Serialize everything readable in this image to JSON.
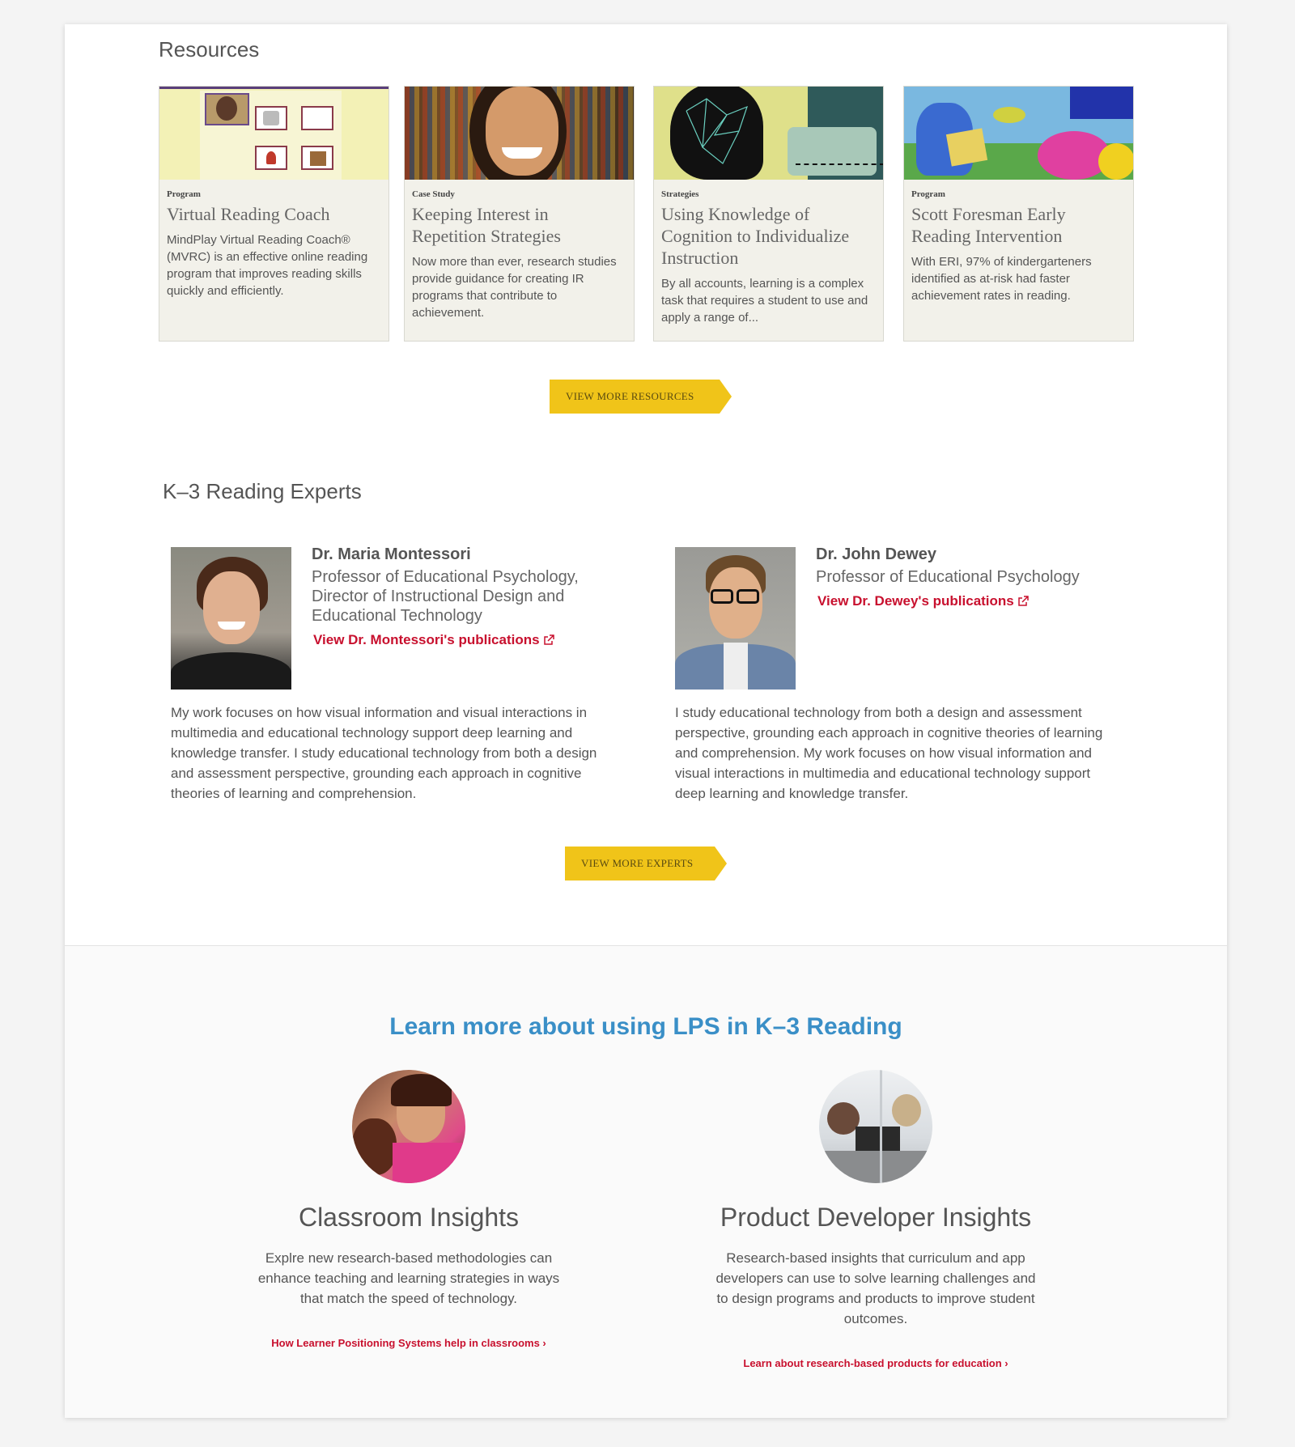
{
  "resources": {
    "title": "Resources",
    "cards": [
      {
        "type": "Program",
        "title": "Virtual Reading Coach",
        "desc": "MindPlay Virtual Reading Coach® (MVRC) is an effective online reading program that improves reading skills quickly and efficiently."
      },
      {
        "type": "Case Study",
        "title": "Keeping Interest in Repetition Strategies",
        "desc": "Now more than ever, research studies provide guidance for creating IR programs that contribute to achievement."
      },
      {
        "type": "Strategies",
        "title": "Using Knowledge of Cognition to Individualize Instruction",
        "desc": "By all accounts, learning is a complex task that requires a student to use and apply a range of..."
      },
      {
        "type": "Program",
        "title": "Scott Foresman Early Reading Intervention",
        "desc": "With ERI, 97% of kindergarteners identified as at-risk had faster achievement rates in reading."
      }
    ],
    "view_more": "VIEW MORE RESOURCES"
  },
  "experts": {
    "title": "K–3 Reading Experts",
    "items": [
      {
        "name": "Dr. Maria Montessori",
        "role": "Professor of Educational Psychology, Director of Instructional Design and Educational Technology",
        "link": "View Dr. Montessori's publications",
        "bio": "My work focuses on how visual information and visual interactions in multimedia and educational technology support deep learning and knowledge transfer. I study educational technology from both a design and assessment perspective, grounding each approach in cognitive theories of learning and comprehension."
      },
      {
        "name": "Dr. John Dewey",
        "role": "Professor of Educational Psychology",
        "link": "View Dr. Dewey's publications",
        "bio": "I study educational technology from both a design and assessment perspective, grounding each approach in cognitive theories of learning and comprehension. My work focuses on how visual information and visual interactions in multimedia and educational technology support deep learning and knowledge transfer."
      }
    ],
    "view_more": "VIEW MORE EXPERTS"
  },
  "learn": {
    "title": "Learn more about using LPS in K–3 Reading",
    "items": [
      {
        "title": "Classroom Insights",
        "desc": "Explre new research-based methodologies can enhance teaching and learning strategies in ways that match the speed of technology.",
        "link": "How Learner Positioning Systems help in classrooms ›"
      },
      {
        "title": "Product Developer Insights",
        "desc": "Research-based insights that curriculum and app developers can use to solve learning challenges and to design programs and products to improve student outcomes.",
        "link": "Learn about research-based products for education ›"
      }
    ]
  },
  "colors": {
    "accent_yellow": "#f0c419",
    "link_red": "#c8102e",
    "heading_blue": "#3a8fc7"
  }
}
